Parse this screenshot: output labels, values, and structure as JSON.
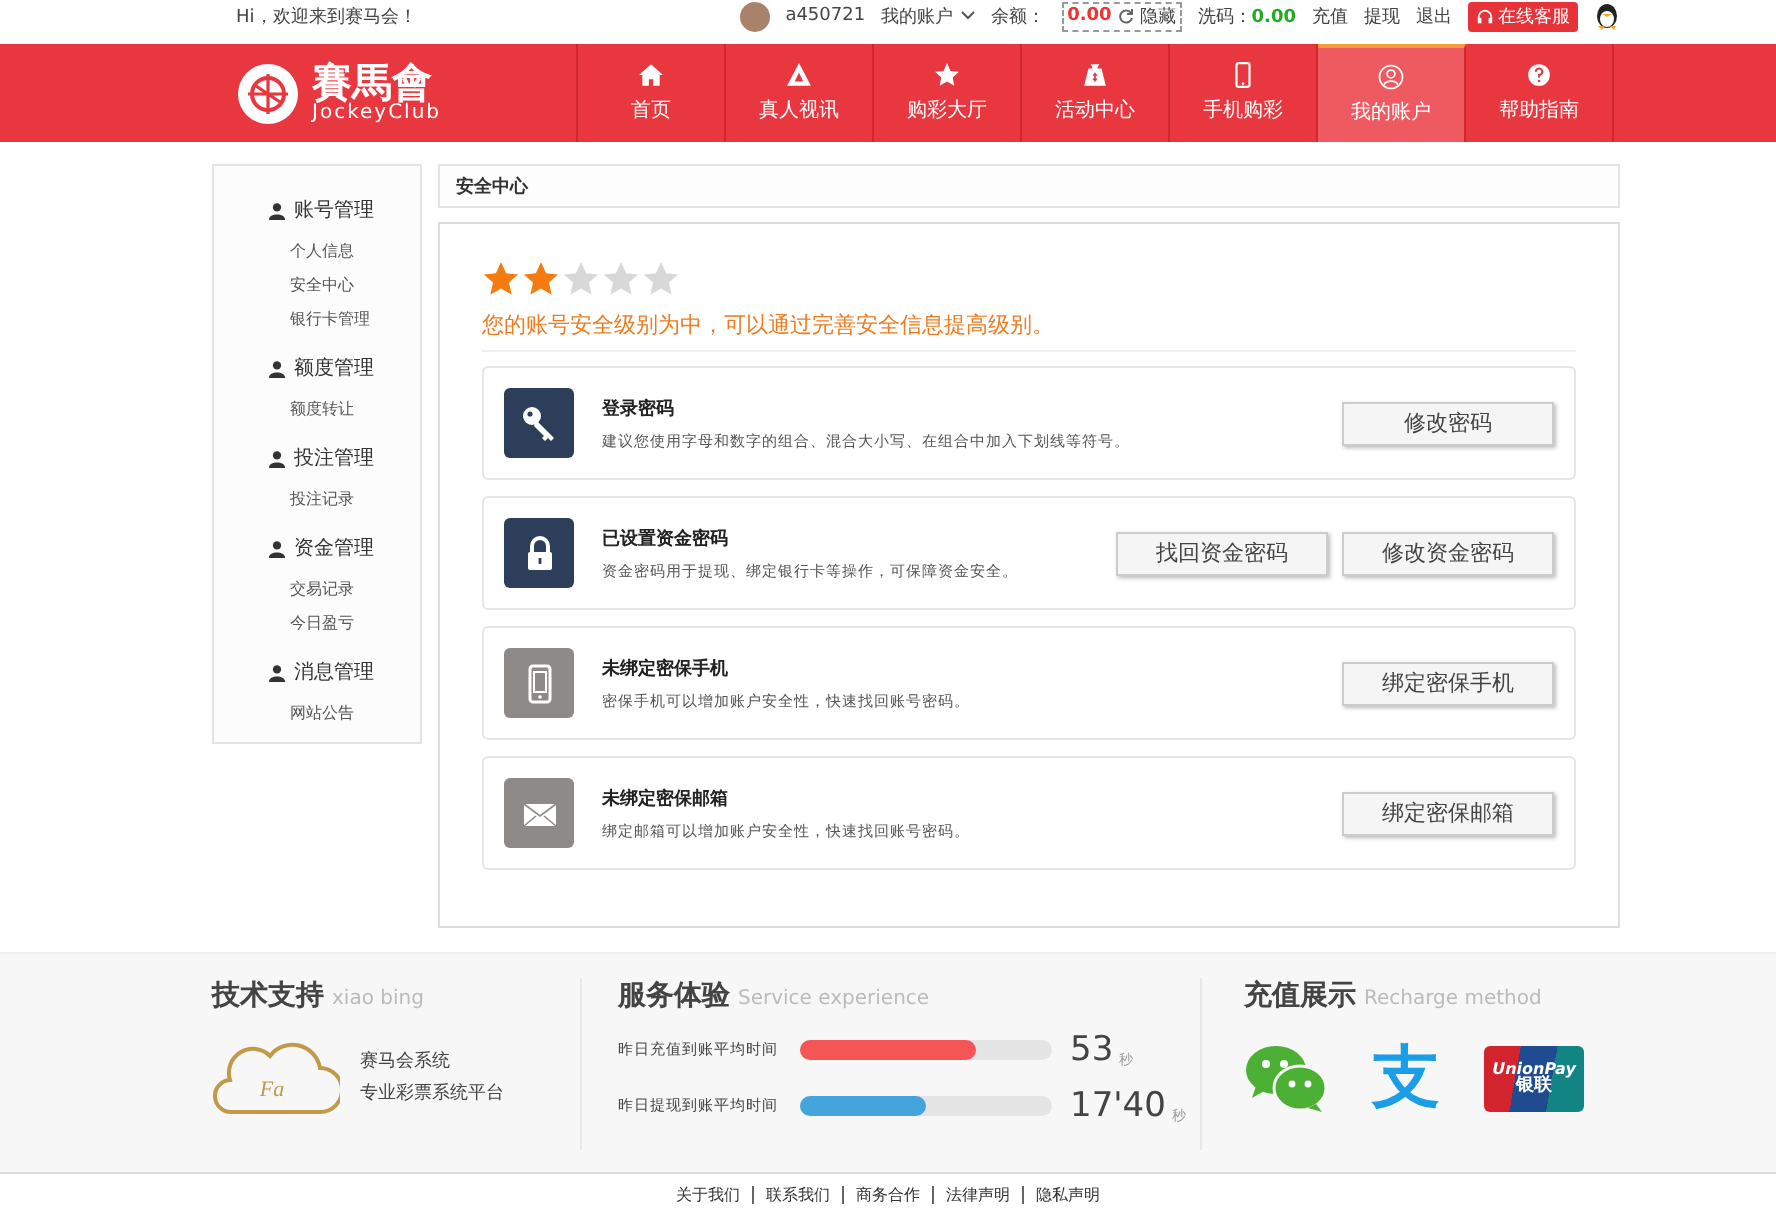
{
  "top_bar": {
    "greeting": "Hi，欢迎来到赛马会！",
    "username": "a450721",
    "account_menu": "我的账户",
    "balance_label": "余额：",
    "balance": "0.00",
    "hide_label": "隐藏",
    "wash_label": "洗码：",
    "wash_value": "0.00",
    "links": [
      "充值",
      "提现",
      "退出"
    ],
    "service_button": "在线客服"
  },
  "nav": {
    "logo_cn": "賽馬會",
    "logo_en": "JockeyClub",
    "items": [
      {
        "label": "首页",
        "kind": "home",
        "selected": false
      },
      {
        "label": "真人视讯",
        "kind": "live",
        "selected": false
      },
      {
        "label": "购彩大厅",
        "kind": "star",
        "selected": false
      },
      {
        "label": "活动中心",
        "kind": "bag",
        "selected": false
      },
      {
        "label": "手机购彩",
        "kind": "phone",
        "selected": false
      },
      {
        "label": "我的账户",
        "kind": "user",
        "selected": true
      },
      {
        "label": "帮助指南",
        "kind": "help",
        "selected": false
      }
    ]
  },
  "sidebar": {
    "groups": [
      {
        "title": "账号管理",
        "items": [
          "个人信息",
          "安全中心",
          "银行卡管理"
        ]
      },
      {
        "title": "额度管理",
        "items": [
          "额度转让"
        ]
      },
      {
        "title": "投注管理",
        "items": [
          "投注记录"
        ]
      },
      {
        "title": "资金管理",
        "items": [
          "交易记录",
          "今日盈亏"
        ]
      },
      {
        "title": "消息管理",
        "items": [
          "网站公告"
        ]
      }
    ]
  },
  "breadcrumb": "安全中心",
  "security": {
    "stars": 2,
    "message": "您的账号安全级别为中，可以通过完善安全信息提高级别。",
    "items": [
      {
        "kind": "key",
        "set": true,
        "title": "登录密码",
        "description": "建议您使用字母和数字的组合、混合大小写、在组合中加入下划线等符号。",
        "buttons": [
          "修改密码"
        ]
      },
      {
        "kind": "lock",
        "set": true,
        "title": "已设置资金密码",
        "description": "资金密码用于提现、绑定银行卡等操作，可保障资金安全。",
        "buttons": [
          "找回资金密码",
          "修改资金密码"
        ]
      },
      {
        "kind": "phone",
        "set": false,
        "title": "未绑定密保手机",
        "description": "密保手机可以增加账户安全性，快速找回账号密码。",
        "buttons": [
          "绑定密保手机"
        ]
      },
      {
        "kind": "mail",
        "set": false,
        "title": "未绑定密保邮箱",
        "description": "绑定邮箱可以增加账户安全性，快速找回账号密码。",
        "buttons": [
          "绑定密保邮箱"
        ]
      }
    ]
  },
  "footer": {
    "support": {
      "title": "技术支持",
      "subtitle": "xiao bing",
      "logo_text": "Fa",
      "lines": [
        "赛马会系统",
        "专业彩票系统平台"
      ]
    },
    "service": {
      "title": "服务体验",
      "subtitle": "Service experience",
      "metrics": [
        {
          "label": "昨日充值到账平均时间",
          "level": 0.7,
          "color": "#f55555",
          "value": "53",
          "unit": "秒"
        },
        {
          "label": "昨日提现到账平均时间",
          "level": 0.5,
          "color": "#44a4dc",
          "value": "17'40",
          "unit": "秒"
        }
      ]
    },
    "recharge": {
      "title": "充值展示",
      "subtitle": "Recharge method",
      "methods": [
        {
          "kind": "wechat"
        },
        {
          "kind": "alipay",
          "text": "支"
        },
        {
          "kind": "unionpay",
          "text": "UnionPay",
          "text_cn": "银联"
        }
      ]
    }
  },
  "links": [
    "关于我们",
    "联系我们",
    "商务合作",
    "法律声明",
    "隐私声明"
  ]
}
